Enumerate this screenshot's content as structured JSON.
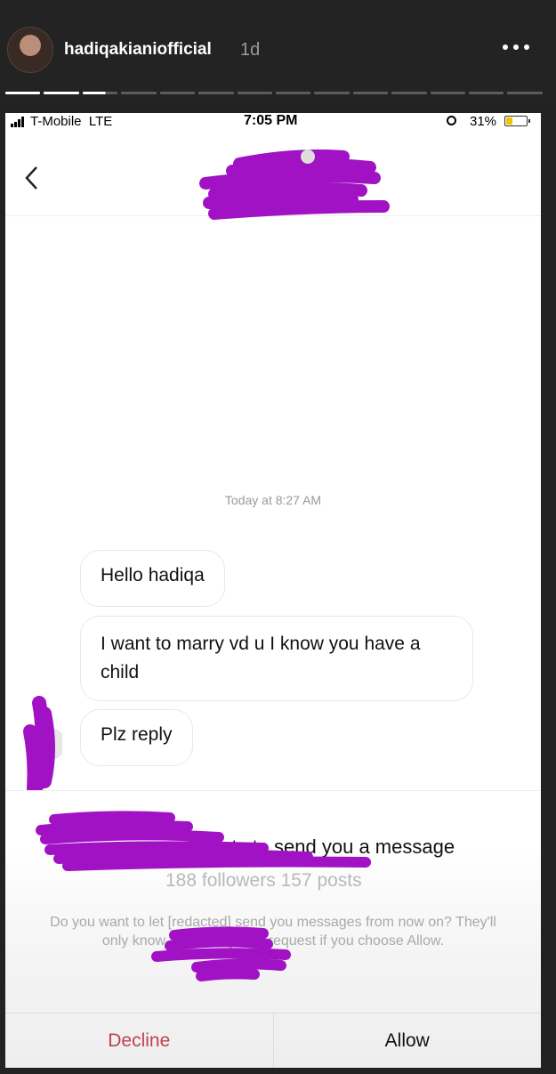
{
  "story": {
    "username": "hadiqakianiofficial",
    "time_ago": "1d",
    "more_icon": "more-dots-icon",
    "progress": {
      "segments": 14,
      "completed": 2,
      "current_fill": 0.65
    }
  },
  "status_bar": {
    "carrier": "T-Mobile  LTE",
    "time": "7:05 PM",
    "battery_percent": "31%",
    "battery_level": 0.31
  },
  "nav": {
    "back_icon": "chevron-left-icon"
  },
  "thread": {
    "timestamp": "Today at 8:27 AM",
    "messages": [
      {
        "text": "Hello hadiqa"
      },
      {
        "text": "I want to marry vd u I know you have a child"
      },
      {
        "text": "Plz reply"
      }
    ]
  },
  "request": {
    "title": "wants to send you a message",
    "stats": "188 followers 157 posts",
    "description": "Do you want to let [redacted] send you messages from now on? They'll only know [redacted] their request if you choose Allow.",
    "decline_label": "Decline",
    "allow_label": "Allow"
  },
  "colors": {
    "redaction": "#a012c4",
    "decline": "#c0424e",
    "story_bg": "#232323"
  }
}
